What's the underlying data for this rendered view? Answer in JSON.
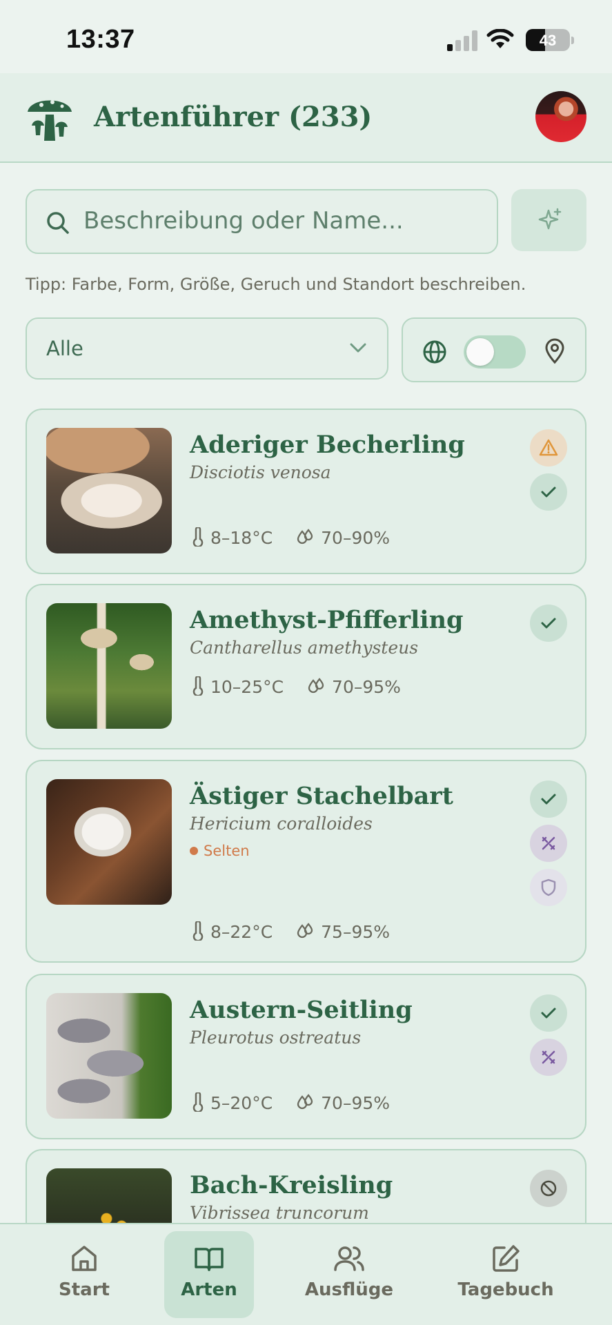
{
  "status": {
    "time": "13:37",
    "battery": "43"
  },
  "header": {
    "title": "Artenführer (233)",
    "logo_icon": "mushroom-logo-icon",
    "avatar_icon": "user-avatar"
  },
  "search": {
    "placeholder": "Beschreibung oder Name...",
    "tip": "Tipp: Farbe, Form, Größe, Geruch und Standort beschreiben."
  },
  "filter": {
    "selected": "Alle",
    "location_toggle_on": false
  },
  "species": [
    {
      "name": "Aderiger Becherling",
      "latin": "Disciotis venosa",
      "temp": "8–18°C",
      "humidity": "70–90%",
      "badges": [
        "warning-icon",
        "check-icon"
      ]
    },
    {
      "name": "Amethyst-Pfifferling",
      "latin": "Cantharellus amethysteus",
      "temp": "10–25°C",
      "humidity": "70–95%",
      "badges": [
        "check-icon"
      ]
    },
    {
      "name": "Ästiger Stachelbart",
      "latin": "Hericium coralloides",
      "rarity": "Selten",
      "temp": "8–22°C",
      "humidity": "75–95%",
      "badges": [
        "check-icon",
        "dna-icon",
        "shield-icon"
      ]
    },
    {
      "name": "Austern-Seitling",
      "latin": "Pleurotus ostreatus",
      "temp": "5–20°C",
      "humidity": "70–95%",
      "badges": [
        "check-icon",
        "dna-icon"
      ]
    },
    {
      "name": "Bach-Kreisling",
      "latin": "Vibrissea truncorum",
      "badges": [
        "ban-icon"
      ]
    }
  ],
  "nav": {
    "start": "Start",
    "arten": "Arten",
    "ausfluege": "Ausflüge",
    "tagebuch": "Tagebuch",
    "active": "Arten"
  },
  "colors": {
    "accent": "#2d6345",
    "background": "#ecf3ef",
    "card": "#e3efe8",
    "rare": "#d07a4a"
  }
}
